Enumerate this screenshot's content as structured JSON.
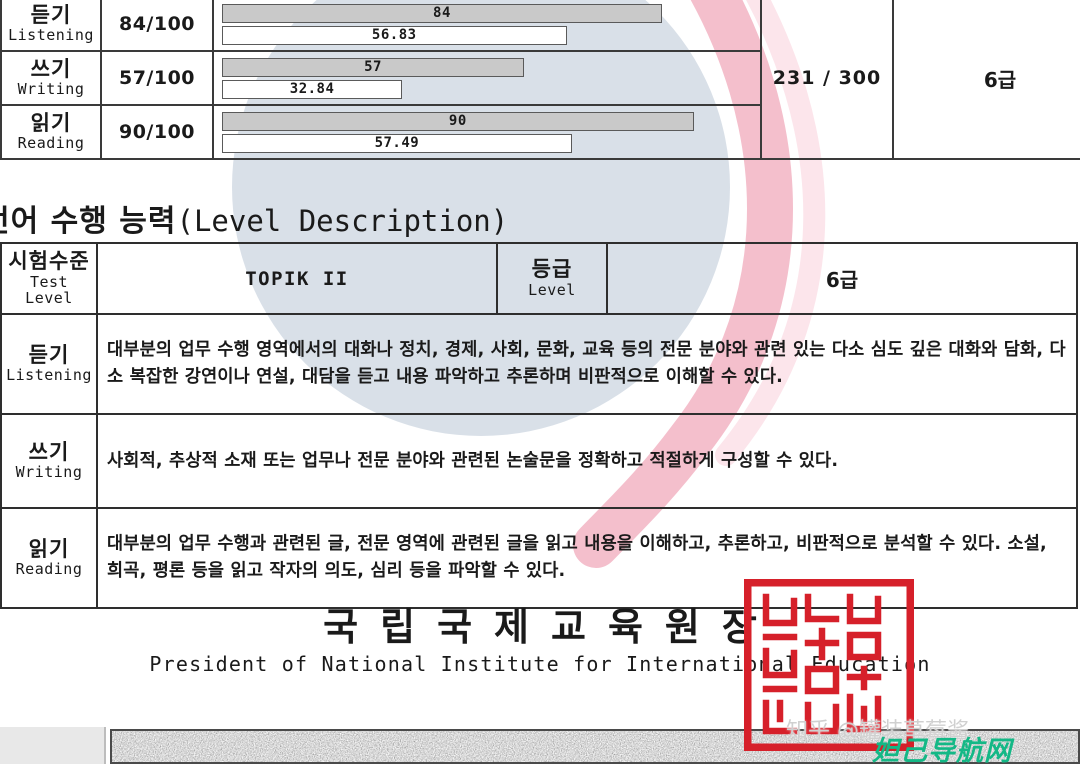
{
  "score_table": {
    "rows": [
      {
        "area_kr": "듣기",
        "area_en": "Listening",
        "score": "84/100",
        "bar_filled_label": "84",
        "bar_filled_value": 84,
        "bar_hollow_label": "56.83",
        "bar_hollow_value": 56.83
      },
      {
        "area_kr": "쓰기",
        "area_en": "Writing",
        "score": "57/100",
        "bar_filled_label": "57",
        "bar_filled_value": 57,
        "bar_hollow_label": "32.84",
        "bar_hollow_value": 32.84
      },
      {
        "area_kr": "읽기",
        "area_en": "Reading",
        "score": "90/100",
        "bar_filled_label": "90",
        "bar_filled_value": 90,
        "bar_hollow_label": "57.49",
        "bar_hollow_value": 57.49
      }
    ],
    "total": "231 / 300",
    "level": "6급"
  },
  "level_section": {
    "heading_kr": "언어 수행 능력",
    "heading_en": "(Level Description)",
    "header": {
      "test_level_kr": "시험수준",
      "test_level_en": "Test Level",
      "test_level_value": "TOPIK II",
      "level_kr": "등급",
      "level_en": "Level",
      "level_value": "6급"
    },
    "rows": [
      {
        "key_kr": "듣기",
        "key_en": "Listening",
        "description": "대부분의 업무 수행 영역에서의 대화나 정치, 경제, 사회, 문화, 교육 등의 전문 분야와 관련  있는 다소 심도 깊은 대화와 담화, 다소 복잡한 강연이나 연설, 대담을 듣고 내용 파악하고 추론하며 비판적으로 이해할 수 있다."
      },
      {
        "key_kr": "쓰기",
        "key_en": "Writing",
        "description": "사회적, 추상적 소재 또는 업무나 전문 분야와 관련된 논술문을 정확하고 적절하게 구성할 수 있다."
      },
      {
        "key_kr": "읽기",
        "key_en": "Reading",
        "description": "대부분의 업무 수행과 관련된 글, 전문 영역에 관련된 글을 읽고 내용을 이해하고, 추론하고, 비판적으로 분석할 수 있다. 소설, 희곡, 평론 등을 읽고 작자의 의도, 심리 등을 파악할 수 있다."
      }
    ]
  },
  "signature": {
    "title_kr": "국립국제교육원장",
    "title_en": "President of National Institute for  International Education",
    "seal_text": "국립국제교육원장인"
  },
  "watermarks": {
    "zhihu": "知乎 @罐装草莓酱",
    "site": "妲己导航网"
  },
  "colors": {
    "bar_fill": "#c9c9c9",
    "seal_red": "#d6202a",
    "watermark_blue": "#b9c6d6",
    "watermark_pink": "#f3b8c6",
    "site_green": "#14b886"
  }
}
